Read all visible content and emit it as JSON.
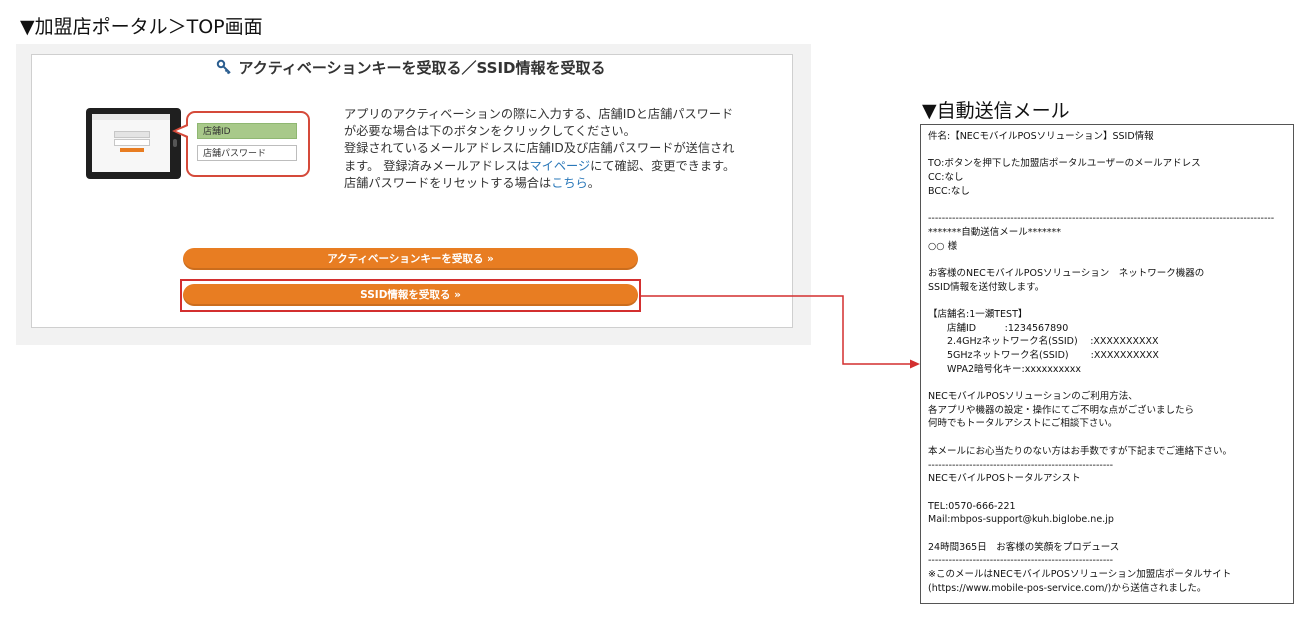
{
  "top_section_title": "▼加盟店ポータル＞TOP画面",
  "mail_section_title": "▼自動送信メール",
  "portal": {
    "heading": "アクティベーションキーを受取る／SSID情報を受取る",
    "illustration": {
      "field_id_label": "店舗ID",
      "field_password_label": "店舗パスワード"
    },
    "description": {
      "line1": "アプリのアクティベーションの際に入力する、店舗IDと店舗パスワードが必要な場合は下のボタンをクリックしてください。",
      "line2_pre": "登録されているメールアドレスに店舗ID及び店舗パスワードが送信されます。 登録済みメールアドレスは",
      "line2_link": "マイページ",
      "line2_post": "にて確認、変更できます。",
      "line3_pre": "店舗パスワードをリセットする場合は",
      "line3_link": "こちら",
      "line3_post": "。"
    },
    "activation_button": "アクティベーションキーを受取る »",
    "ssid_button": "SSID情報を受取る »"
  },
  "mail_lines": [
    "件名:【NECモバイルPOSソリューション】SSID情報",
    "",
    "TO:ボタンを押下した加盟店ポータルユーザーのメールアドレス",
    "CC:なし",
    "BCC:なし",
    "",
    "-----------------------------------------------------------------------------------------------------",
    "*******自動送信メール*******",
    "○○ 様",
    "",
    "お客様のNECモバイルPOSソリューション　ネットワーク機器の",
    "SSID情報を送付致します。",
    "",
    "【店舗名:1一瀬TEST】",
    "　　店舗ID　　　:1234567890",
    "　　2.4GHzネットワーク名(SSID)　 :XXXXXXXXXX",
    "　　5GHzネットワーク名(SSID)　　 :XXXXXXXXXX",
    "　　WPA2暗号化キー:xxxxxxxxxx",
    "",
    "NECモバイルPOSソリューションのご利用方法、",
    "各アプリや機器の設定・操作にてご不明な点がございましたら",
    "何時でもトータルアシストにご相談下さい。",
    "",
    "本メールにお心当たりのない方はお手数ですが下記までご連絡下さい。",
    "------------------------------------------------------",
    "NECモバイルPOSトータルアシスト",
    "",
    "TEL:0570-666-221",
    "Mail:mbpos-support@kuh.biglobe.ne.jp",
    "",
    "24時間365日　お客様の笑顔をプロデュース",
    "------------------------------------------------------",
    "※このメールはNECモバイルPOSソリューション加盟店ポータルサイト",
    "(https://www.mobile-pos-service.com/)から送信されました。"
  ],
  "colors": {
    "accent_orange": "#e87d22",
    "highlight_red": "#d32f2f",
    "field_green": "#a8c98a",
    "link_blue": "#2a78b9"
  }
}
